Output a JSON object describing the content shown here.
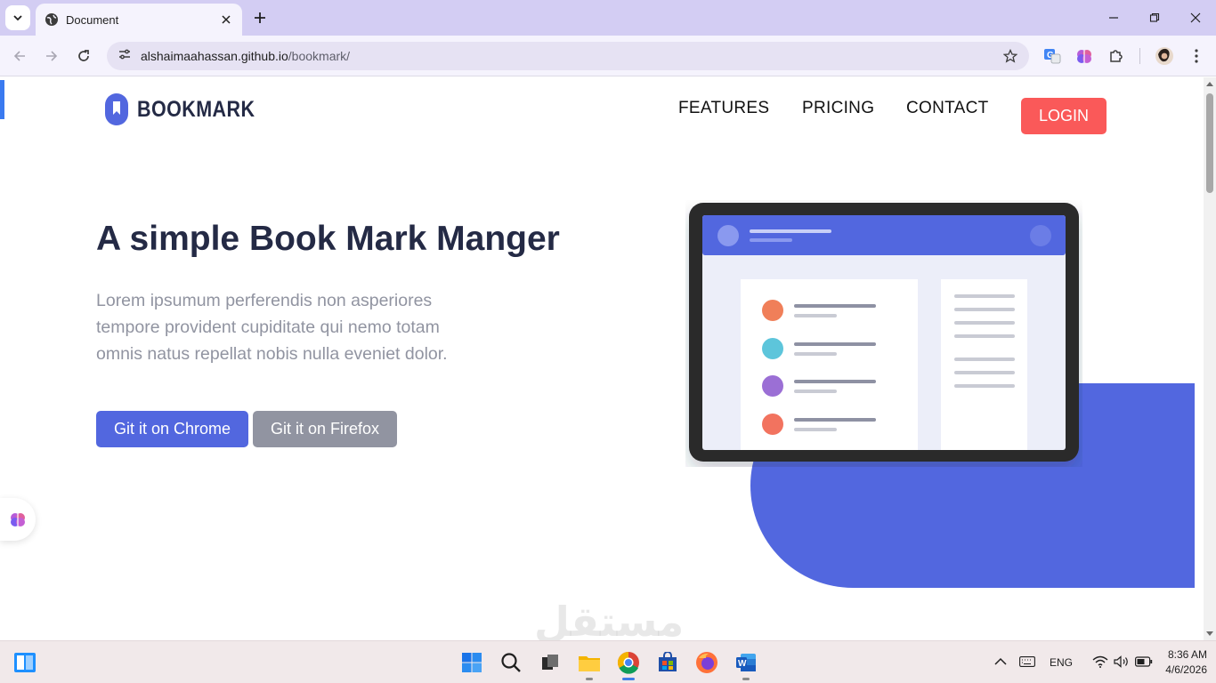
{
  "browser": {
    "tab_title": "Document",
    "url_host": "alshaimaahassan.github.io",
    "url_path": "/bookmark/"
  },
  "site": {
    "logo_text": "BOOKMARK",
    "nav": [
      "FEATURES",
      "PRICING",
      "CONTACT"
    ],
    "login_label": "LOGIN",
    "hero_title": "A simple Book Mark Manger",
    "hero_text": "Lorem ipsumum perferendis non asperiores tempore provident cupiditate qui nemo totam omnis natus repellat nobis nulla eveniet dolor.",
    "btn_chrome": "Git it on Chrome",
    "btn_firefox": "Git it on Firefox"
  },
  "watermark": "مستقل",
  "colors": {
    "primary": "#5267df",
    "accent": "#fa5959",
    "heading": "#242a45",
    "muted": "#9194a1"
  },
  "taskbar": {
    "apps": [
      "start-icon",
      "search-icon",
      "task-view-icon",
      "file-explorer-icon",
      "chrome-icon",
      "store-icon",
      "firefox-icon",
      "word-icon"
    ],
    "language": "ENG",
    "time": "8:36 AM",
    "date": "4/6/2026"
  }
}
